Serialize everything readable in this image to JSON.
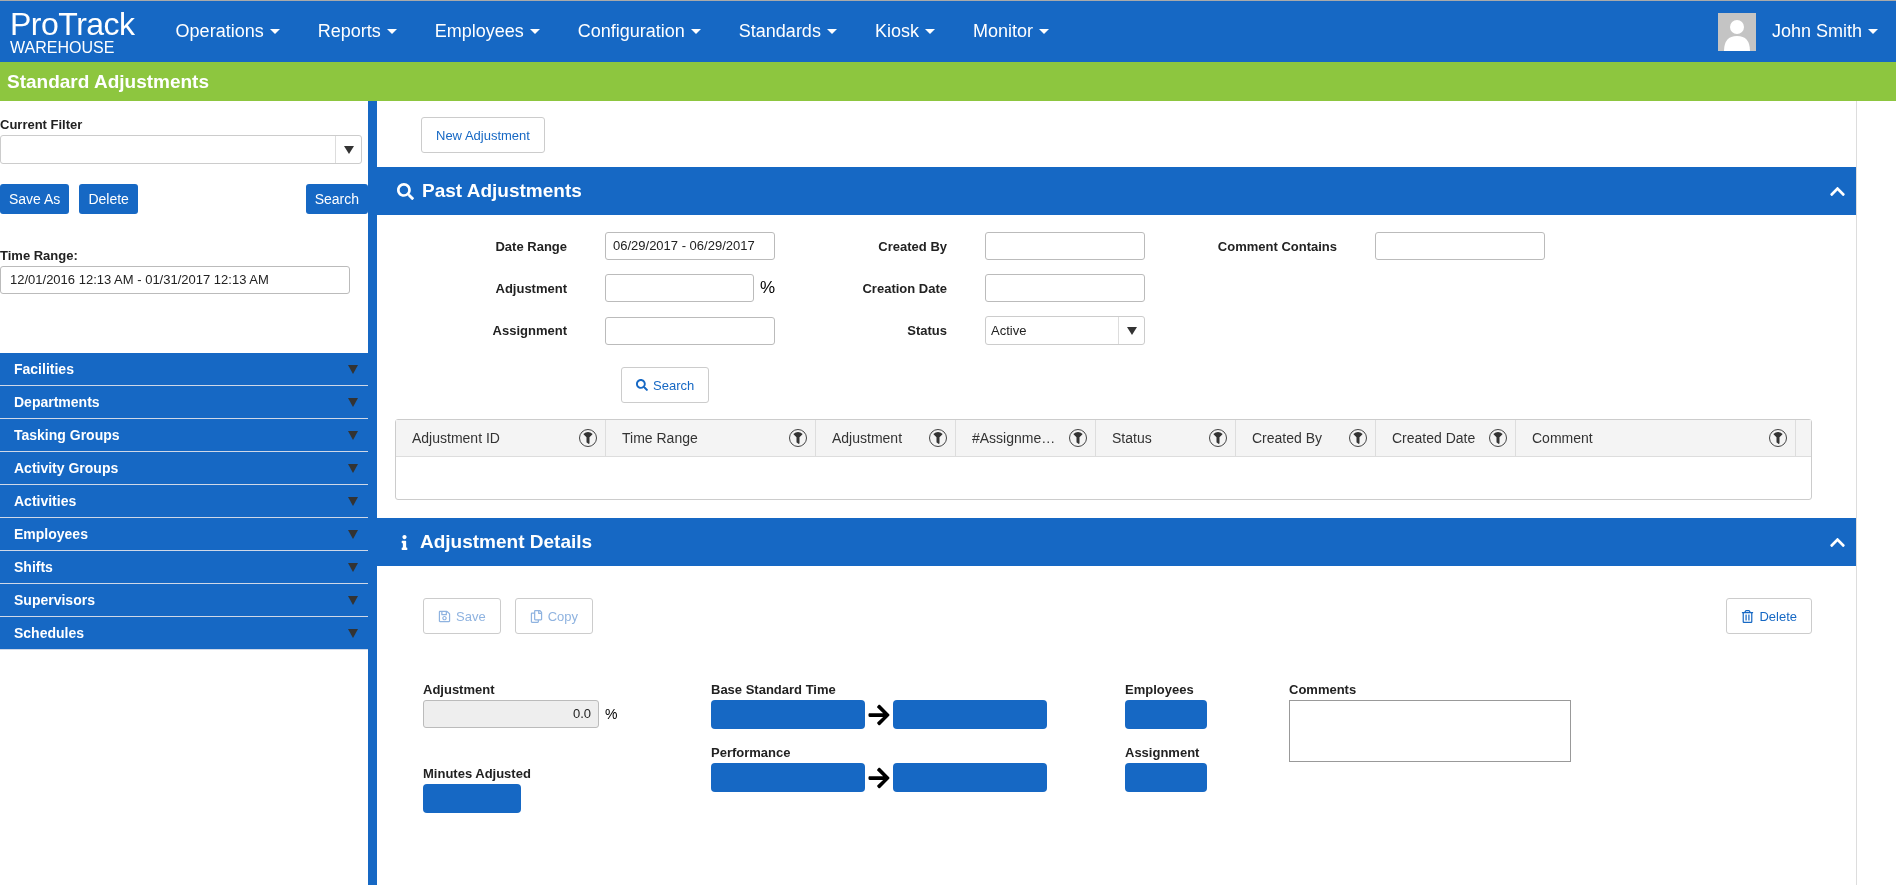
{
  "nav": {
    "logo_main": "ProTrack",
    "logo_sub": "WAREHOUSE",
    "menus": [
      "Operations",
      "Reports",
      "Employees",
      "Configuration",
      "Standards",
      "Kiosk",
      "Monitor"
    ],
    "user": "John Smith"
  },
  "page_title": "Standard Adjustments",
  "sidebar": {
    "filter_label": "Current Filter",
    "buttons": [
      "Save As",
      "Delete",
      "Search"
    ],
    "time_label": "Time Range:",
    "time_value": "12/01/2016 12:13 AM - 01/31/2017 12:13 AM",
    "groups": [
      {
        "label": "Facilities",
        "expanded": false
      },
      {
        "label": "Departments",
        "expanded": false
      },
      {
        "label": "Tasking Groups",
        "expanded": false
      },
      {
        "label": "Activity Groups",
        "expanded": false
      },
      {
        "label": "Activities",
        "expanded": false
      },
      {
        "label": "Employees",
        "expanded": false
      },
      {
        "label": "Shifts",
        "expanded": false
      },
      {
        "label": "Supervisors",
        "expanded": false
      },
      {
        "label": "Schedules",
        "expanded": false
      }
    ]
  },
  "new_button": "New Adjustment",
  "past": {
    "title": "Past Adjustments",
    "fields": [
      {
        "label": "Date Range",
        "kind": "text",
        "value": "06/29/2017 - 06/29/2017"
      },
      {
        "label": "Created By",
        "kind": "text"
      },
      {
        "label": "Comment Contains",
        "kind": "text"
      },
      {
        "label": "Adjustment",
        "kind": "text",
        "suffix": "%"
      },
      {
        "label": "Creation Date",
        "kind": "text"
      },
      {
        "label": "Assignment",
        "kind": "text"
      },
      {
        "label": "Status",
        "kind": "select",
        "value": "Active"
      }
    ],
    "search": "Search",
    "columns": [
      "Adjustment ID",
      "Time Range",
      "Adjustment",
      "#Assignme…",
      "Status",
      "Created By",
      "Created Date",
      "Comment"
    ]
  },
  "details": {
    "title": "Adjustment Details",
    "buttons": [
      {
        "label": "Save",
        "disabled": true
      },
      {
        "label": "Copy",
        "disabled": true
      },
      {
        "label": "Delete",
        "disabled": false
      }
    ],
    "adjustment_label": "Adjustment",
    "adjustment_value": "0.0",
    "adjustment_suffix": "%",
    "minutes_label": "Minutes Adjusted",
    "base_label": "Base Standard Time",
    "performance_label": "Performance",
    "employees_label": "Employees",
    "assignment_label": "Assignment",
    "comments_label": "Comments"
  }
}
